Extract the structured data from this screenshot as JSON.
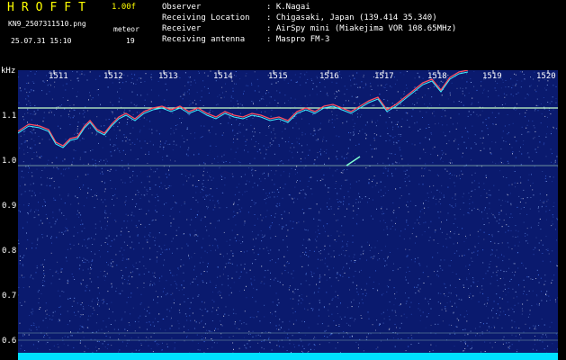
{
  "header": {
    "app_title": "HROFFT",
    "version": "1.00f",
    "filename": "KN9_2507311510.png",
    "datetime": "25.07.31 15:10",
    "meteor_label": "meteor",
    "meteor_count": "19",
    "info": [
      {
        "label": "Observer",
        "value": ": K.Nagai"
      },
      {
        "label": "Receiving Location",
        "value": ": Chigasaki, Japan (139.414 35.340)"
      },
      {
        "label": "Receiver",
        "value": ": AirSpy mini (Miakejima VOR 108.65MHz)"
      },
      {
        "label": "Receiving antenna",
        "value": ": Maspro FM-3"
      }
    ]
  },
  "spectrogram": {
    "y_unit": "kHz",
    "y_ticks": [
      "1.1",
      "1.0",
      "0.9",
      "0.8",
      "0.7",
      "0.6"
    ],
    "x_ticks": [
      "1511",
      "1512",
      "1513",
      "1514",
      "1515",
      "1516",
      "1517",
      "1518",
      "1519",
      "1520"
    ],
    "colors": {
      "background": "#0a1a6e",
      "noise": "#6fa0ff",
      "signal_line": "#c8ffc8",
      "trace_red": "#ff5060",
      "trace_cyan": "#40f0ff",
      "baseline": "#00e0ff"
    }
  }
}
